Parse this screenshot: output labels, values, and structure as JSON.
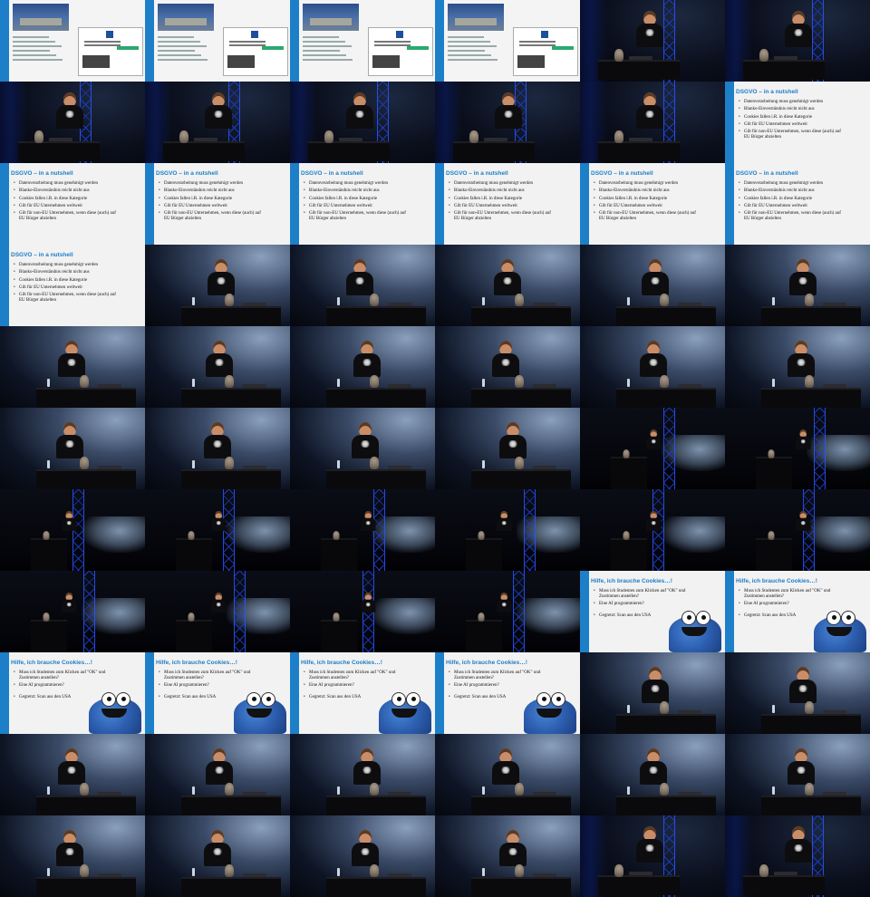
{
  "slides": {
    "dsgvo": {
      "title": "DSGVO – in a nutshell",
      "bullets": [
        "Datenverarbeitung muss genehmigt werden",
        "Blanko-Einverständnis reicht nicht aus",
        "Cookies fallen i.R. in diese Kategorie",
        "Gilt für EU Unternehmen weltweit",
        "Gilt für non-EU Unternehmen, wenn diese (auch) auf EU Bürger abzielten"
      ]
    },
    "cookies": {
      "title": "Hilfe, ich brauche Cookies…!",
      "bullets": [
        "Muss ich Studenten zum Klicken auf \"OK\" und Zustimmen anstellen?",
        "Eine AI programmieren?",
        "Gegretzt: Scan aus den USA"
      ]
    }
  },
  "cells": [
    "title",
    "title",
    "title",
    "title",
    "stage-lit",
    "stage-lit",
    "stage-lit",
    "stage-lit",
    "stage-lit",
    "stage-lit",
    "stage-lit",
    "dsgvo",
    "dsgvo",
    "dsgvo",
    "dsgvo",
    "dsgvo",
    "dsgvo",
    "dsgvo",
    "dsgvo",
    "close",
    "close",
    "close",
    "close",
    "close",
    "close",
    "close",
    "close",
    "close",
    "close",
    "close",
    "close",
    "close",
    "close",
    "close",
    "wide",
    "wide",
    "wide",
    "wide",
    "wide",
    "wide",
    "wide",
    "wide",
    "wide",
    "wide",
    "wide",
    "wide",
    "cookies",
    "cookies",
    "cookies",
    "cookies",
    "cookies",
    "cookies",
    "close",
    "close",
    "close",
    "close",
    "close",
    "close",
    "close",
    "close",
    "close",
    "close",
    "close",
    "close",
    "stage-lit",
    "stage-lit"
  ]
}
